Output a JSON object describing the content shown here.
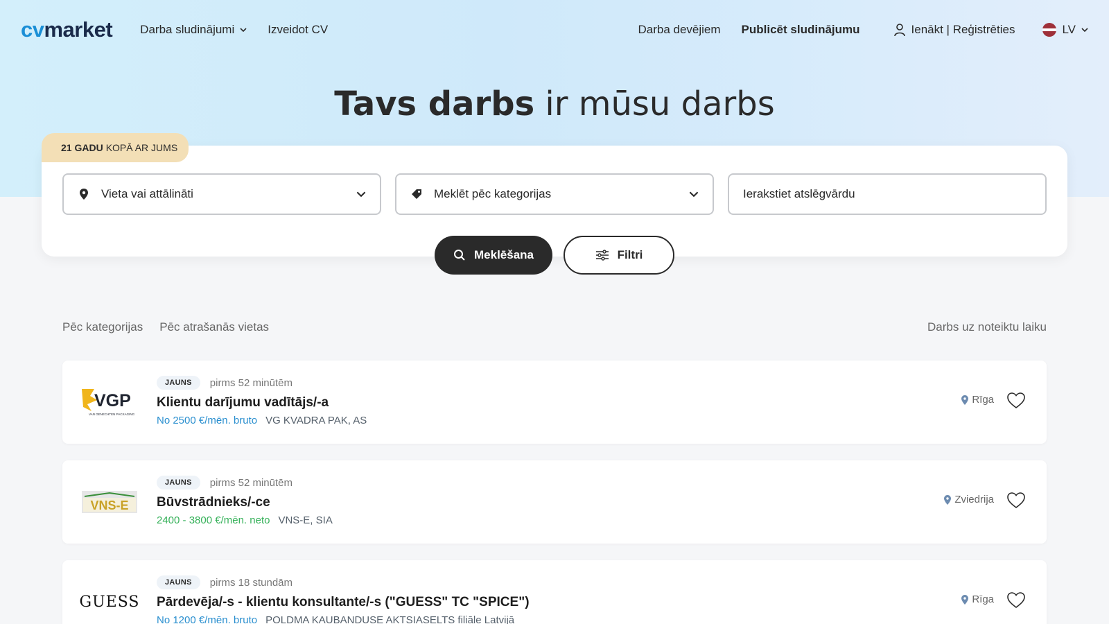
{
  "header": {
    "logo": {
      "cv": "cv",
      "market": "market"
    },
    "nav": {
      "jobs": "Darba sludinājumi",
      "create_cv": "Izveidot CV"
    },
    "employers": "Darba devējiem",
    "publish": "Publicēt sludinājumu",
    "login": "Ienākt | Reģistrēties",
    "lang": "LV"
  },
  "hero": {
    "title_bold": "Tavs darbs",
    "title_light": " ir mūsu darbs"
  },
  "badge": {
    "bold": "21 GADU",
    "rest": "KOPĀ AR JUMS"
  },
  "search": {
    "location_label": "Vieta vai attālināti",
    "category_label": "Meklēt pēc kategorijas",
    "keyword_placeholder": "Ierakstiet atslēgvārdu",
    "search_button": "Meklēšana",
    "filter_button": "Filtri"
  },
  "subnav": {
    "by_category": "Pēc kategorijas",
    "by_location": "Pēc atrašanās vietas",
    "temporary": "Darbs uz noteiktu laiku"
  },
  "jobs": [
    {
      "tag": "JAUNS",
      "time": "pirms 52 minūtēm",
      "title": "Klientu darījumu vadītājs/-a",
      "salary": "No 2500 €/mēn. bruto",
      "salary_color": "#2a8fcf",
      "company": "VG KVADRA PAK, AS",
      "location": "Rīga",
      "logo_text": "VGP",
      "logo_sub": "VAN GENECHTEN PACKAGING"
    },
    {
      "tag": "JAUNS",
      "time": "pirms 52 minūtēm",
      "title": "Būvstrādnieks/-ce",
      "salary": "2400 - 3800 €/mēn. neto",
      "salary_color": "#36b15a",
      "company": "VNS-E, SIA",
      "location": "Zviedrija",
      "logo_text": "VNS-E"
    },
    {
      "tag": "JAUNS",
      "time": "pirms 18 stundām",
      "title": "Pārdevēja/-s - klientu konsultante/-s (\"GUESS\" TC \"SPICE\")",
      "salary": "No 1200 €/mēn. bruto",
      "salary_color": "#2a8fcf",
      "company": "POLDMA KAUBANDUSE AKTSIASELTS filiāle Latvijā",
      "location": "Rīga",
      "logo_text": "GUESS"
    }
  ]
}
